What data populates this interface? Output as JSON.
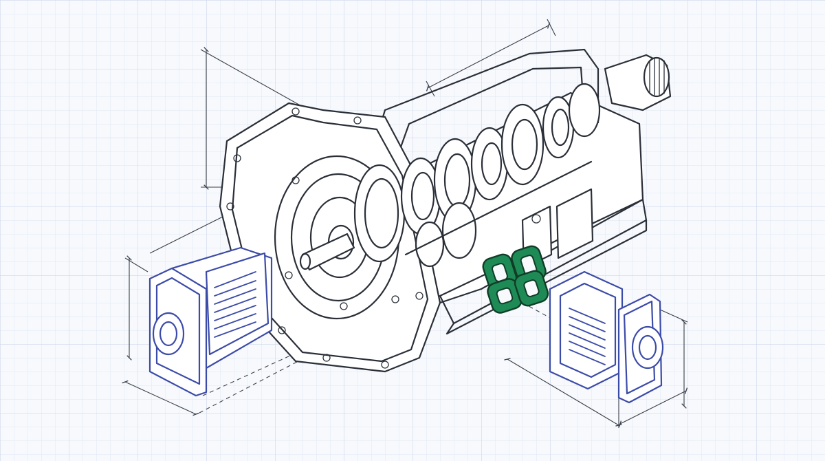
{
  "diagram": {
    "style": "technical blueprint line drawing on grid paper",
    "colors": {
      "background": "#f7f9fd",
      "grid": "#d3dcec",
      "ink": "#2a2f38",
      "accent_blue": "#3b4ba8",
      "accent_green": "#1e8a55"
    },
    "components": [
      {
        "id": "transmission-housing",
        "icon": "transmission-cutaway"
      },
      {
        "id": "left-filter-cartridge",
        "icon": "filter-cartridge",
        "color": "#3b4ba8"
      },
      {
        "id": "right-filter-cartridge",
        "icon": "filter-cartridge",
        "color": "#3b4ba8"
      },
      {
        "id": "linkage-chain",
        "icon": "chain-link",
        "color": "#1e8a55"
      }
    ]
  }
}
